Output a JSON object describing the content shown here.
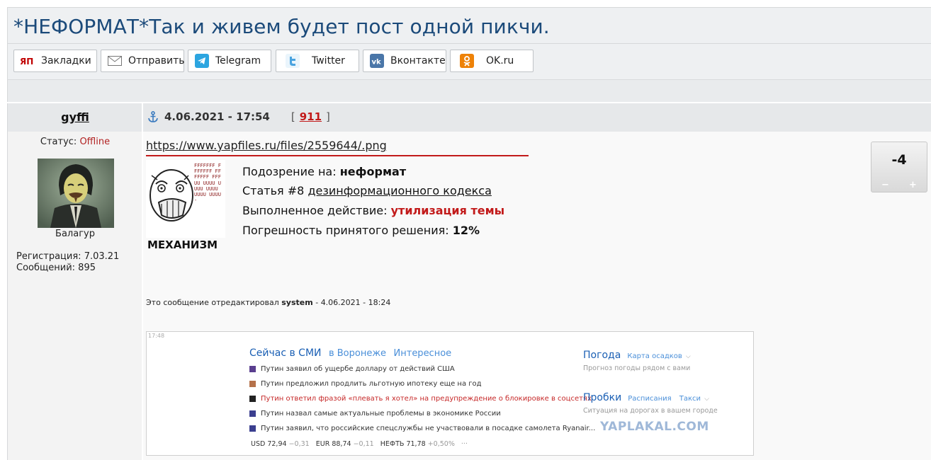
{
  "page": {
    "title": "*НЕФОРМАТ*Так и живем будет пост одной пикчи."
  },
  "share": [
    {
      "label": "Закладки",
      "icon": "yap-bookmarks-icon",
      "color": "#c00000"
    },
    {
      "label": "Отправить",
      "icon": "envelope-icon",
      "color": "#777777"
    },
    {
      "label": "Telegram",
      "icon": "telegram-icon",
      "color": "#2ca5e0"
    },
    {
      "label": "Twitter",
      "icon": "twitter-icon",
      "color": "#4aa3df"
    },
    {
      "label": "Вконтакте",
      "icon": "vk-icon",
      "color": "#4a76a8"
    },
    {
      "label": "OK.ru",
      "icon": "odnoklassniki-icon",
      "color": "#ee8208"
    }
  ],
  "post": {
    "author": "gyffi",
    "status_label": "Статус:",
    "status_value": "Offline",
    "rank": "Балагур",
    "reg_label": "Регистрация:",
    "reg_value": "7.03.21",
    "msgs_label": "Сообщений:",
    "msgs_value": "895",
    "date": "4.06.2021 - 17:54",
    "post_number": "911",
    "bracket_open": "[",
    "bracket_close": "]",
    "link": "https://www.yapfiles.ru/files/2559644/.png",
    "meme_label": "МЕХАНИЗМ",
    "meme_f_text": "FFFFFFF FFFFFFF FFFFFFF FFFUU UUUU UUUU UUUU UUUU UUUU-",
    "verdict": {
      "suspicion_label": "Подозрение на:",
      "suspicion_value": "неформат",
      "article_label": "Статья #8",
      "article_link": "дезинформационного кодекса",
      "action_label": "Выполненное действие:",
      "action_value": "утилизация темы",
      "error_label": "Погрешность принятого решения:",
      "error_value": "12%"
    },
    "edit_prefix": "Это сообщение отредактировал",
    "edit_user": "system",
    "edit_sep": "-",
    "edit_date": "4.06.2021 - 18:24",
    "vote": {
      "score": "-4",
      "minus": "−",
      "plus": "+"
    }
  },
  "screenshot": {
    "time": "17:48",
    "tab_main": "Сейчас в СМИ",
    "tab_city": "в Воронеже",
    "tab_interesting": "Интересное",
    "news": [
      {
        "text": "Путин заявил об ущербе доллару от действий США",
        "color": "#333333",
        "icon_color": "#5a3f8f"
      },
      {
        "text": "Путин предложил продлить льготную ипотеку еще на год",
        "color": "#333333",
        "icon_color": "#b5714a"
      },
      {
        "text": "Путин ответил фразой «плевать я хотел» на предупреждение о блокировке в соцсетях",
        "color": "#c62828",
        "icon_color": "#222222"
      },
      {
        "text": "Путин назвал самые актуальные проблемы в экономике России",
        "color": "#333333",
        "icon_color": "#3b3f8f"
      },
      {
        "text": "Путин заявил, что российские спецслужбы не участвовали в посадке самолета Ryanair...",
        "color": "#333333",
        "icon_color": "#3b3f8f"
      }
    ],
    "rates": [
      {
        "name": "USD",
        "value": "72,94",
        "change": "−0,31"
      },
      {
        "name": "EUR",
        "value": "88,74",
        "change": "−0,11"
      },
      {
        "name": "НЕФТЬ",
        "value": "71,78",
        "change": "+0,50%"
      }
    ],
    "rates_more": "···",
    "weather_title": "Погода",
    "weather_link": "Карта осадков",
    "weather_sub": "Прогноз погоды рядом с вами",
    "traffic_title": "Пробки",
    "traffic_link1": "Расписания",
    "traffic_link2": "Такси",
    "traffic_sub": "Ситуация на дорогах в вашем городе",
    "watermark": "YAPLAKAL.COM"
  }
}
